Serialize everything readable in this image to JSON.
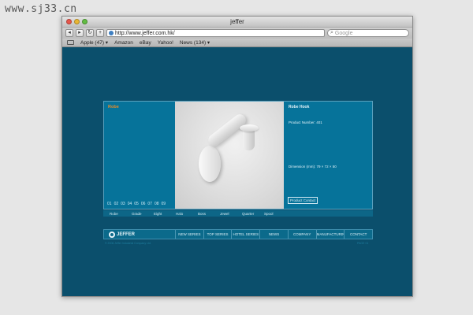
{
  "watermark": "www.sj33.cn",
  "window": {
    "title": "jeffer"
  },
  "toolbar": {
    "back": "◂",
    "forward": "▸",
    "reload": "↻",
    "add": "+",
    "url": "http://www.jeffer.com.hk/",
    "search_placeholder": "Google"
  },
  "bookmarks": [
    "Apple (47) ▾",
    "Amazon",
    "eBay",
    "Yahoo!",
    "News (134) ▾"
  ],
  "product": {
    "brand": "Robe",
    "title": "Robe Hook",
    "number": "Product Number: 401",
    "dimension": "Dimension (mm): 79 × 72 × 50",
    "contact": "Product Contact",
    "pages": [
      "01",
      "02",
      "03",
      "04",
      "05",
      "06",
      "07",
      "08",
      "09"
    ]
  },
  "series": [
    "Robe",
    "Grade",
    "Eight",
    "Halo",
    "Boss",
    "Jewel",
    "Quarter",
    "Spool"
  ],
  "footer": {
    "logo": "JEFFER",
    "nav": [
      "NEW SERIES",
      "TOP SERIES",
      "HOTEL SERIES",
      "NEWS",
      "COMPANY",
      "MANUFACTURING",
      "CONTACT"
    ],
    "copyright": "© 2006 Jeffer Industrial Company Ltd.",
    "right_text": "PAGE 01"
  }
}
